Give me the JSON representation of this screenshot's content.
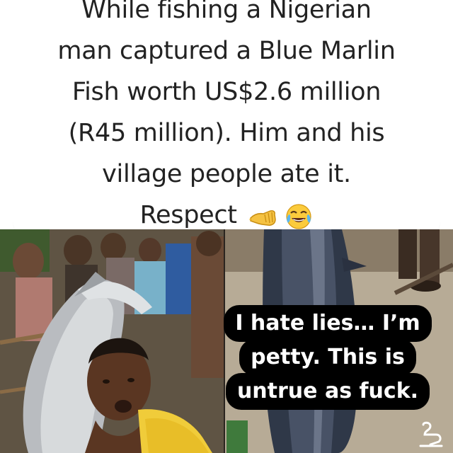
{
  "caption": {
    "lines": [
      "While fishing a Nigerian",
      "man captured a Blue Marlin",
      "Fish worth US$2.6 million",
      "(R45 million). Him and his",
      "village people ate it.",
      "Respect"
    ],
    "emojis": [
      "raised-fist-emoji",
      "face-with-tears-of-joy-emoji"
    ]
  },
  "meme_overlay": {
    "lines": [
      "I hate lies… I’m",
      "petty. This is",
      "untrue as fuck."
    ]
  },
  "photos": {
    "left": "man-with-blue-marlin-photo",
    "right": "blue-marlin-on-ground-photo"
  },
  "colors": {
    "accent": "#e2592c",
    "caption_text": "#222222",
    "overlay_bg": "#000000",
    "overlay_text": "#ffffff"
  }
}
